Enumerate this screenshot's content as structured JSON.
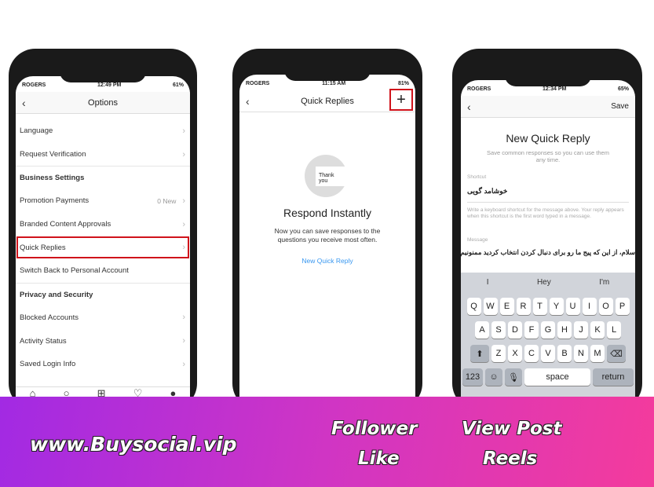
{
  "phone1": {
    "status": {
      "carrier": "ROGERS",
      "time": "12:49 PM",
      "battery": "61%"
    },
    "title": "Options",
    "rows": [
      {
        "label": "Language",
        "type": "item"
      },
      {
        "label": "Request Verification",
        "type": "item"
      },
      {
        "label": "Business Settings",
        "type": "head"
      },
      {
        "label": "Promotion Payments",
        "type": "item",
        "badge": "0 New"
      },
      {
        "label": "Branded Content Approvals",
        "type": "item"
      },
      {
        "label": "Quick Replies",
        "type": "item",
        "highlight": true
      },
      {
        "label": "Switch Back to Personal Account",
        "type": "plain"
      },
      {
        "label": "Privacy and Security",
        "type": "head"
      },
      {
        "label": "Blocked Accounts",
        "type": "item"
      },
      {
        "label": "Activity Status",
        "type": "item"
      },
      {
        "label": "Saved Login Info",
        "type": "item"
      }
    ],
    "tabbar": [
      "home-icon",
      "search-icon",
      "add-icon",
      "heart-icon",
      "profile-icon"
    ]
  },
  "phone2": {
    "status": {
      "carrier": "ROGERS",
      "time": "11:15 AM",
      "battery": "81%"
    },
    "title": "Quick Replies",
    "add": "+",
    "bubble": "Thank you",
    "heading": "Respond Instantly",
    "body": "Now you can save responses to the questions you receive most often.",
    "link": "New Quick Reply",
    "accent": "#3897f0"
  },
  "phone3": {
    "status": {
      "carrier": "ROGERS",
      "time": "12:34 PM",
      "battery": "65%"
    },
    "save": "Save",
    "heading": "New Quick Reply",
    "sub": "Save common responses so you can use them any time.",
    "shortcut_label": "Shortcut",
    "shortcut_value": "خوشامد گویی",
    "hint": "Write a keyboard shortcut for the message above. Your reply appears when this shortcut is the first word typed in a message.",
    "message_label": "Message",
    "message_value": "سلام، از این که پیج ما رو برای دنبال کردن انتخاب کردید ممنونیم",
    "suggestions": [
      "I",
      "Hey",
      "I'm"
    ],
    "keys": [
      [
        "Q",
        "W",
        "E",
        "R",
        "T",
        "Y",
        "U",
        "I",
        "O",
        "P"
      ],
      [
        "A",
        "S",
        "D",
        "F",
        "G",
        "H",
        "J",
        "K",
        "L"
      ],
      [
        "Z",
        "X",
        "C",
        "V",
        "B",
        "N",
        "M"
      ]
    ],
    "k123": "123",
    "space": "space",
    "return": "return"
  },
  "banner": {
    "site": "www.Buysocial.vip",
    "items": [
      "Follower",
      "View Post",
      "Like",
      "Reels"
    ]
  }
}
